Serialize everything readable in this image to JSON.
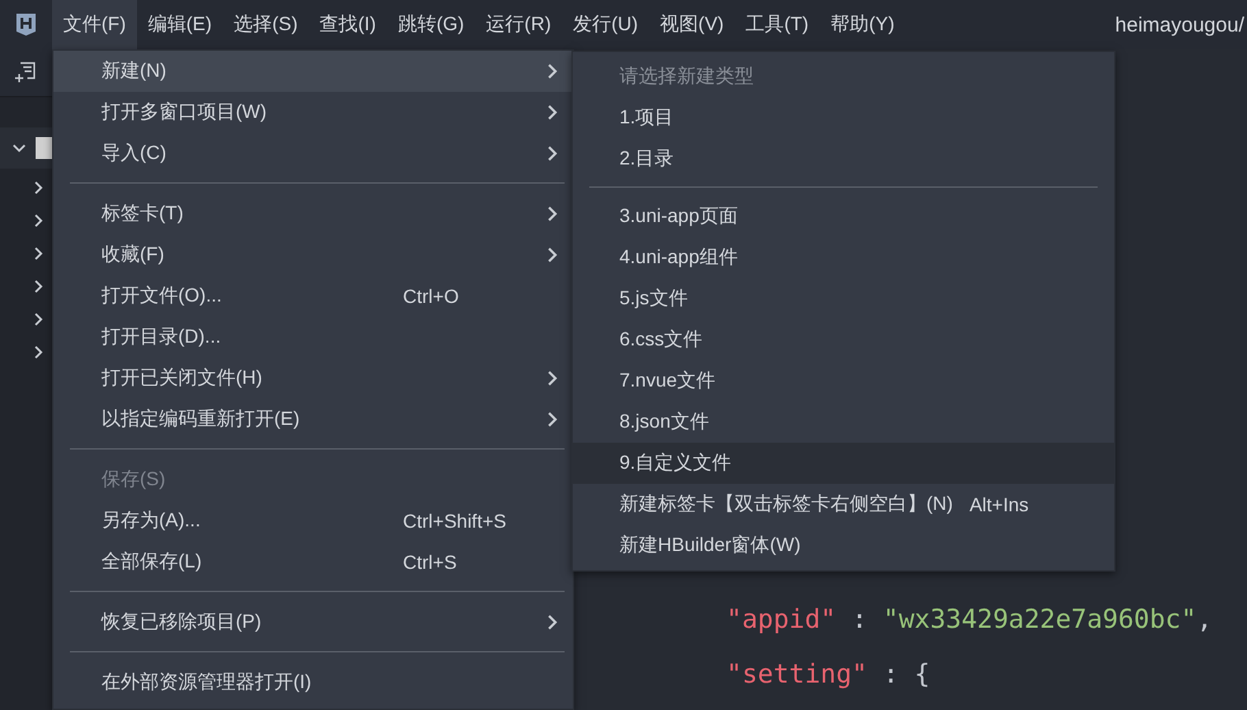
{
  "menubar": {
    "items": [
      {
        "label": "文件(F)",
        "selected": true
      },
      {
        "label": "编辑(E)",
        "selected": false
      },
      {
        "label": "选择(S)",
        "selected": false
      },
      {
        "label": "查找(I)",
        "selected": false
      },
      {
        "label": "跳转(G)",
        "selected": false
      },
      {
        "label": "运行(R)",
        "selected": false
      },
      {
        "label": "发行(U)",
        "selected": false
      },
      {
        "label": "视图(V)",
        "selected": false
      },
      {
        "label": "工具(T)",
        "selected": false
      },
      {
        "label": "帮助(Y)",
        "selected": false
      }
    ],
    "project_title": "heimayougou/"
  },
  "file_menu": {
    "items": [
      {
        "kind": "item",
        "label": "新建(N)",
        "submenu": true,
        "selected": true,
        "disabled": false
      },
      {
        "kind": "item",
        "label": "打开多窗口项目(W)",
        "submenu": true,
        "selected": false,
        "disabled": false
      },
      {
        "kind": "item",
        "label": "导入(C)",
        "submenu": true,
        "selected": false,
        "disabled": false
      },
      {
        "kind": "separator"
      },
      {
        "kind": "item",
        "label": "标签卡(T)",
        "submenu": true,
        "selected": false,
        "disabled": false
      },
      {
        "kind": "item",
        "label": "收藏(F)",
        "submenu": true,
        "selected": false,
        "disabled": false
      },
      {
        "kind": "item",
        "label": "打开文件(O)...",
        "shortcut": "Ctrl+O",
        "submenu": false,
        "selected": false,
        "disabled": false
      },
      {
        "kind": "item",
        "label": "打开目录(D)...",
        "submenu": false,
        "selected": false,
        "disabled": false
      },
      {
        "kind": "item",
        "label": "打开已关闭文件(H)",
        "submenu": true,
        "selected": false,
        "disabled": false
      },
      {
        "kind": "item",
        "label": "以指定编码重新打开(E)",
        "submenu": true,
        "selected": false,
        "disabled": false
      },
      {
        "kind": "separator"
      },
      {
        "kind": "item",
        "label": "保存(S)",
        "submenu": false,
        "selected": false,
        "disabled": true
      },
      {
        "kind": "item",
        "label": "另存为(A)...",
        "shortcut": "Ctrl+Shift+S",
        "submenu": false,
        "selected": false,
        "disabled": false
      },
      {
        "kind": "item",
        "label": "全部保存(L)",
        "shortcut": "Ctrl+S",
        "submenu": false,
        "selected": false,
        "disabled": false
      },
      {
        "kind": "separator"
      },
      {
        "kind": "item",
        "label": "恢复已移除项目(P)",
        "submenu": true,
        "selected": false,
        "disabled": false
      },
      {
        "kind": "separator"
      },
      {
        "kind": "item",
        "label": "在外部资源管理器打开(I)",
        "submenu": false,
        "selected": false,
        "disabled": false
      }
    ]
  },
  "new_submenu": {
    "items": [
      {
        "kind": "header",
        "label": "请选择新建类型"
      },
      {
        "kind": "item",
        "label": "1.项目",
        "selected": false
      },
      {
        "kind": "item",
        "label": "2.目录",
        "selected": false
      },
      {
        "kind": "separator"
      },
      {
        "kind": "item",
        "label": "3.uni-app页面",
        "selected": false
      },
      {
        "kind": "item",
        "label": "4.uni-app组件",
        "selected": false
      },
      {
        "kind": "item",
        "label": "5.js文件",
        "selected": false
      },
      {
        "kind": "item",
        "label": "6.css文件",
        "selected": false
      },
      {
        "kind": "item",
        "label": "7.nvue文件",
        "selected": false
      },
      {
        "kind": "item",
        "label": "8.json文件",
        "selected": false
      },
      {
        "kind": "item",
        "label": "9.自定义文件",
        "selected": true
      },
      {
        "kind": "item",
        "label": "新建标签卡【双击标签卡右侧空白】(N)",
        "shortcut": "Alt+Ins",
        "selected": false
      },
      {
        "kind": "item",
        "label": "新建HBuilder窗体(W)",
        "selected": false
      }
    ]
  },
  "editor": {
    "lines": [
      {
        "tokens": [
          {
            "kind": "key",
            "text": "\"appid\""
          },
          {
            "kind": "punct",
            "text": " : "
          },
          {
            "kind": "string",
            "text": "\"wx33429a22e7a960bc\""
          },
          {
            "kind": "punct",
            "text": ","
          }
        ]
      },
      {
        "tokens": [
          {
            "kind": "key",
            "text": "\"setting\""
          },
          {
            "kind": "punct",
            "text": " : {"
          }
        ]
      }
    ]
  }
}
